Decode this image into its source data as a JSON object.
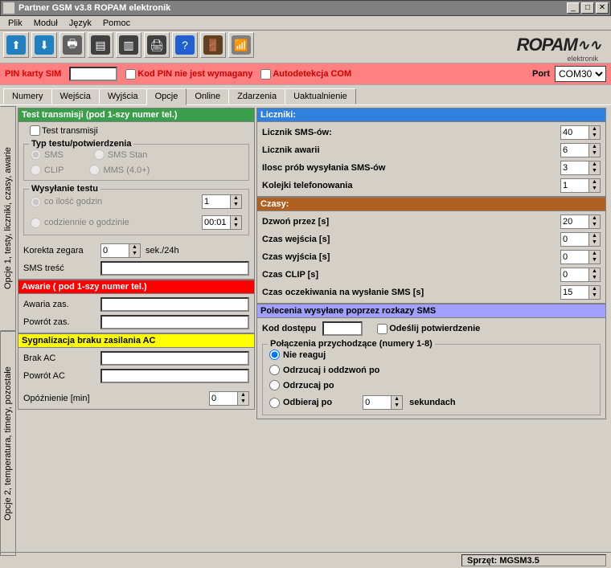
{
  "window_title": "Partner GSM v3.8 ROPAM elektronik",
  "menu": [
    "Plik",
    "Moduł",
    "Język",
    "Pomoc"
  ],
  "logo_main": "ROPAM",
  "logo_sub": "elektronik",
  "pinbar": {
    "label": "PIN karty SIM",
    "value": "",
    "nopin_label": "Kod PIN nie jest wymagany",
    "autodetect_label": "Autodetekcja COM",
    "port_label": "Port",
    "port_value": "COM30"
  },
  "main_tabs": [
    "Numery",
    "Wejścia",
    "Wyjścia",
    "Opcje",
    "Online",
    "Zdarzenia",
    "Uaktualnienie"
  ],
  "main_tab_active": 3,
  "side_tabs": [
    "Opcje 1, testy, liczniki, czasy, awarie",
    "Opcje 2, temperatura, timery, pozostałe"
  ],
  "leftcol": {
    "test_title": "Test transmisji (pod 1-szy numer tel.)",
    "test_check": "Test transmisji",
    "test_type_legend": "Typ testu/potwierdzenia",
    "rb_sms": "SMS",
    "rb_sms_stan": "SMS Stan",
    "rb_clip": "CLIP",
    "rb_mms": "MMS (4.0+)",
    "wys_legend": "Wysyłanie testu",
    "rb_everyhours": "co ilość godzin",
    "rb_daily": "codziennie o godzinie",
    "hours_value": "1",
    "time_value": "00:01",
    "korekta_label": "Korekta zegara",
    "korekta_value": "0",
    "korekta_unit": "sek./24h",
    "sms_tresc_label": "SMS treść",
    "sms_tresc_value": "",
    "awarie_title": "Awarie ( pod 1-szy numer tel.)",
    "awaria_zas": "Awaria zas.",
    "awaria_zas_v": "",
    "powrot_zas": "Powrót zas.",
    "powrot_zas_v": "",
    "ac_title": "Sygnalizacja braku zasilania  AC",
    "brak_ac": "Brak AC",
    "brak_ac_v": "",
    "powrot_ac": "Powrót AC",
    "powrot_ac_v": "",
    "opoz_label": "Opóźnienie [min]",
    "opoz_value": "0"
  },
  "rightcol": {
    "liczniki_title": "Liczniki:",
    "l_sms": "Licznik SMS-ów:",
    "l_sms_v": "40",
    "l_awarii": "Licznik awarii",
    "l_awarii_v": "6",
    "l_prob": "Ilosc prób wysyłania SMS-ów",
    "l_prob_v": "3",
    "l_kolejki": "Kolejki telefonowania",
    "l_kolejki_v": "1",
    "czasy_title": "Czasy:",
    "c_dzwon": "Dzwoń przez [s]",
    "c_dzwon_v": "20",
    "c_wej": "Czas wejścia [s]",
    "c_wej_v": "0",
    "c_wyj": "Czas wyjścia [s]",
    "c_wyj_v": "0",
    "c_clip": "Czas CLIP [s]",
    "c_clip_v": "0",
    "c_ocze": "Czas oczekiwania na wysłanie SMS [s]",
    "c_ocze_v": "15",
    "polecenia_title": "Polecenia wysyłane poprzez rozkazy SMS",
    "kod_label": "Kod dostępu",
    "kod_value": "",
    "odeslij_label": "Odeślij potwierdzenie",
    "pol_legend": "Połączenia przychodzące (numery 1-8)",
    "rb_nie": "Nie reaguj",
    "rb_odrz_odd": "Odrzucaj i oddzwoń po",
    "rb_odrz": "Odrzucaj po",
    "rb_odb": "Odbieraj po",
    "sek_value": "0",
    "sek_unit": "sekundach"
  },
  "status": "Sprzęt: MGSM3.5"
}
